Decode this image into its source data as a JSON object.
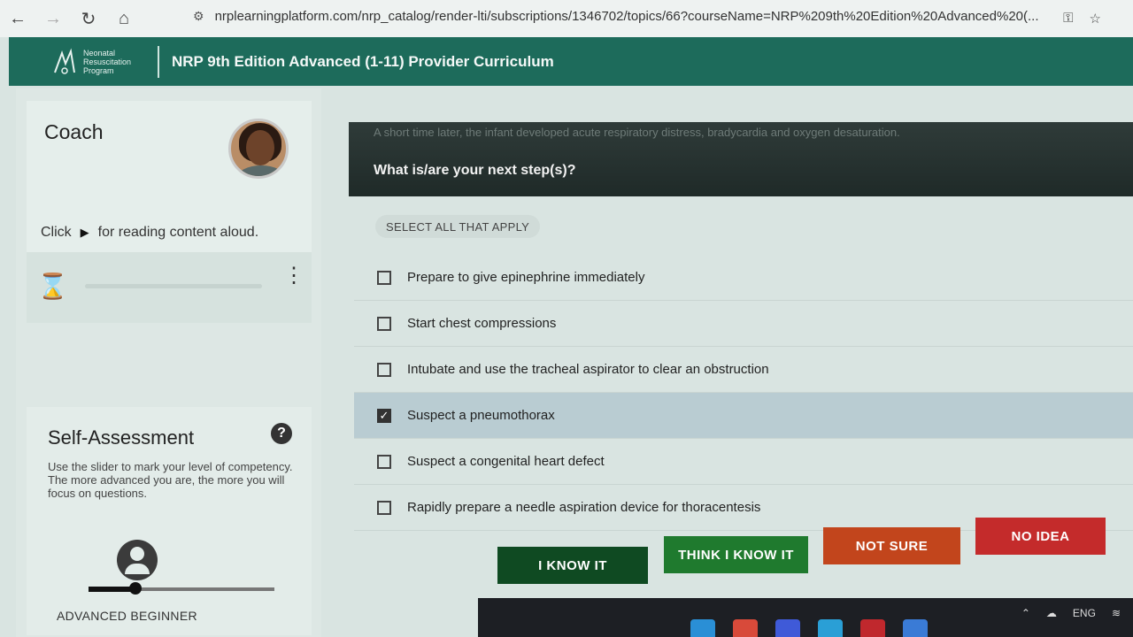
{
  "browser": {
    "url": "nrplearningplatform.com/nrp_catalog/render-lti/subscriptions/1346702/topics/66?courseName=NRP%209th%20Edition%20Advanced%20(..."
  },
  "header": {
    "logo_lines": [
      "Neonatal",
      "Resuscitation",
      "Program"
    ],
    "course_title": "NRP 9th Edition Advanced (1-11) Provider Curriculum"
  },
  "coach": {
    "title": "Coach",
    "read_aloud_prefix": "Click",
    "read_aloud_suffix": "for reading content aloud."
  },
  "self_assessment": {
    "title": "Self-Assessment",
    "help_label": "?",
    "description": "Use the slider to mark your level of competency. The more advanced you are, the more you will focus on questions.",
    "level_label": "ADVANCED BEGINNER",
    "level_fraction": 0.25
  },
  "question": {
    "scenario_text": "A short time later, the infant developed acute respiratory distress, bradycardia and oxygen desaturation.",
    "prompt": "What is/are your next step(s)?",
    "instruction": "SELECT ALL THAT APPLY",
    "options": [
      {
        "text": "Prepare to give epinephrine immediately",
        "checked": false
      },
      {
        "text": "Start chest compressions",
        "checked": false
      },
      {
        "text": "Intubate and use the tracheal aspirator to clear an obstruction",
        "checked": false
      },
      {
        "text": "Suspect a pneumothorax",
        "checked": true
      },
      {
        "text": "Suspect a congenital heart defect",
        "checked": false
      },
      {
        "text": "Rapidly prepare a needle aspiration device for thoracentesis",
        "checked": false
      }
    ]
  },
  "actions": {
    "i_know_it": "I KNOW IT",
    "think_i_know_it": "THINK I KNOW IT",
    "not_sure": "NOT SURE",
    "no_idea": "NO IDEA"
  },
  "taskbar": {
    "language": "ENG"
  }
}
